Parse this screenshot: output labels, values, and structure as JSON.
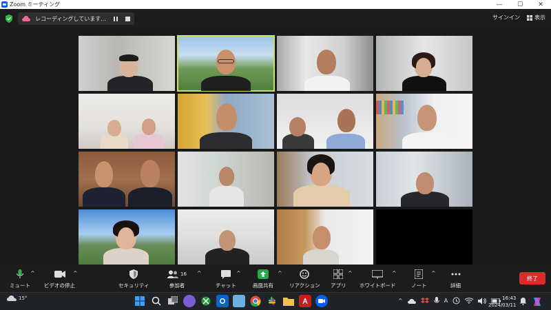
{
  "window": {
    "title": "Zoom ミーティング",
    "controls": [
      "minimize-icon",
      "maximize-icon",
      "close-icon"
    ]
  },
  "topbar": {
    "recording_text": "レコーディングしています...",
    "sign_in": "サインイン",
    "view": "表示"
  },
  "toolbar": {
    "mute": "ミュート",
    "video_stop": "ビデオの停止",
    "security": "セキュリティ",
    "participants": "参加者",
    "participants_count": "16",
    "chat": "チャット",
    "share_screen": "画面共有",
    "reactions": "リアクション",
    "apps": "アプリ",
    "whiteboard": "ホワイトボード",
    "notes": "ノート",
    "more": "詳細",
    "end": "終了",
    "accent_green": "#2aa84a",
    "end_color": "#d92d2d"
  },
  "taskbar": {
    "temperature": "15°",
    "ime": "A",
    "time": "16:43",
    "date": "2024/03/11",
    "apps": [
      "windows-start-icon",
      "search-icon",
      "task-view-icon",
      "chat-icon",
      "xbox-icon",
      "outlook-icon",
      "photos-icon",
      "chrome-icon",
      "slack-icon",
      "file-explorer-icon",
      "acrobat-icon",
      "zoom-icon"
    ]
  },
  "participants": [
    {
      "id": 1,
      "active": false
    },
    {
      "id": 2,
      "active": true
    },
    {
      "id": 3,
      "active": false
    },
    {
      "id": 4,
      "active": false
    },
    {
      "id": 5,
      "active": false
    },
    {
      "id": 6,
      "active": false
    },
    {
      "id": 7,
      "active": false
    },
    {
      "id": 8,
      "active": false
    },
    {
      "id": 9,
      "active": false
    },
    {
      "id": 10,
      "active": false
    },
    {
      "id": 11,
      "active": false
    },
    {
      "id": 12,
      "active": false
    },
    {
      "id": 13,
      "active": false
    },
    {
      "id": 14,
      "active": false
    },
    {
      "id": 15,
      "active": false
    }
  ]
}
